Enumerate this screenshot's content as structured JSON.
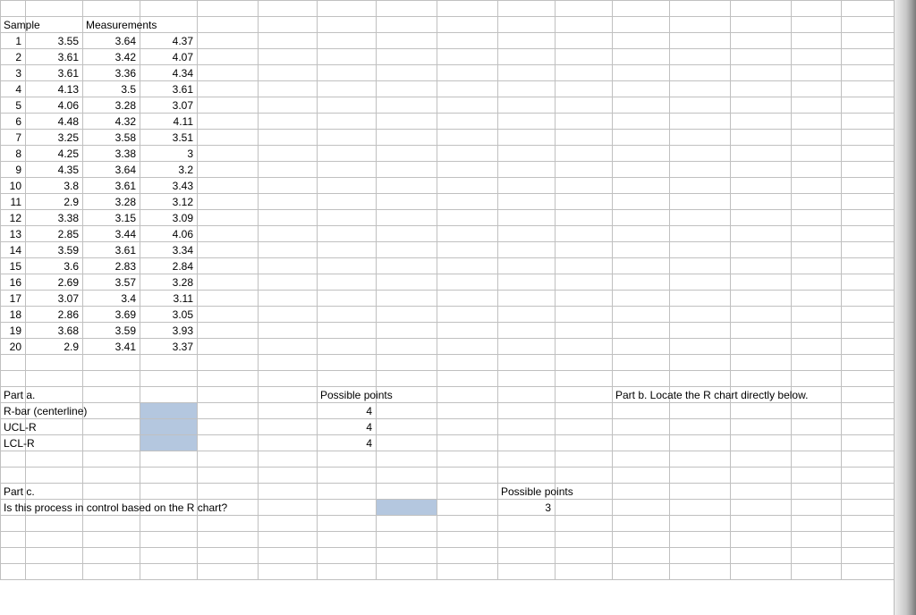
{
  "headers": {
    "sample": "Sample",
    "measurements": "Measurements"
  },
  "samples": [
    {
      "n": "1",
      "m1": "3.55",
      "m2": "3.64",
      "m3": "4.37"
    },
    {
      "n": "2",
      "m1": "3.61",
      "m2": "3.42",
      "m3": "4.07"
    },
    {
      "n": "3",
      "m1": "3.61",
      "m2": "3.36",
      "m3": "4.34"
    },
    {
      "n": "4",
      "m1": "4.13",
      "m2": "3.5",
      "m3": "3.61"
    },
    {
      "n": "5",
      "m1": "4.06",
      "m2": "3.28",
      "m3": "3.07"
    },
    {
      "n": "6",
      "m1": "4.48",
      "m2": "4.32",
      "m3": "4.11"
    },
    {
      "n": "7",
      "m1": "3.25",
      "m2": "3.58",
      "m3": "3.51"
    },
    {
      "n": "8",
      "m1": "4.25",
      "m2": "3.38",
      "m3": "3"
    },
    {
      "n": "9",
      "m1": "4.35",
      "m2": "3.64",
      "m3": "3.2"
    },
    {
      "n": "10",
      "m1": "3.8",
      "m2": "3.61",
      "m3": "3.43"
    },
    {
      "n": "11",
      "m1": "2.9",
      "m2": "3.28",
      "m3": "3.12"
    },
    {
      "n": "12",
      "m1": "3.38",
      "m2": "3.15",
      "m3": "3.09"
    },
    {
      "n": "13",
      "m1": "2.85",
      "m2": "3.44",
      "m3": "4.06"
    },
    {
      "n": "14",
      "m1": "3.59",
      "m2": "3.61",
      "m3": "3.34"
    },
    {
      "n": "15",
      "m1": "3.6",
      "m2": "2.83",
      "m3": "2.84"
    },
    {
      "n": "16",
      "m1": "2.69",
      "m2": "3.57",
      "m3": "3.28"
    },
    {
      "n": "17",
      "m1": "3.07",
      "m2": "3.4",
      "m3": "3.11"
    },
    {
      "n": "18",
      "m1": "2.86",
      "m2": "3.69",
      "m3": "3.05"
    },
    {
      "n": "19",
      "m1": "3.68",
      "m2": "3.59",
      "m3": "3.93"
    },
    {
      "n": "20",
      "m1": "2.9",
      "m2": "3.41",
      "m3": "3.37"
    }
  ],
  "parta": {
    "title": "Part a.",
    "rbar": "R-bar (centerline)",
    "ucl": "UCL-R",
    "lcl": "LCL-R",
    "poss_label": "Possible points",
    "poss": {
      "rbar": "4",
      "ucl": "4",
      "lcl": "4"
    }
  },
  "partb": {
    "title": "Part b. Locate the R chart directly below."
  },
  "partc": {
    "title": "Part c.",
    "question": "Is this process in control based on the R chart?",
    "poss_label": "Possible points",
    "poss": "3"
  }
}
